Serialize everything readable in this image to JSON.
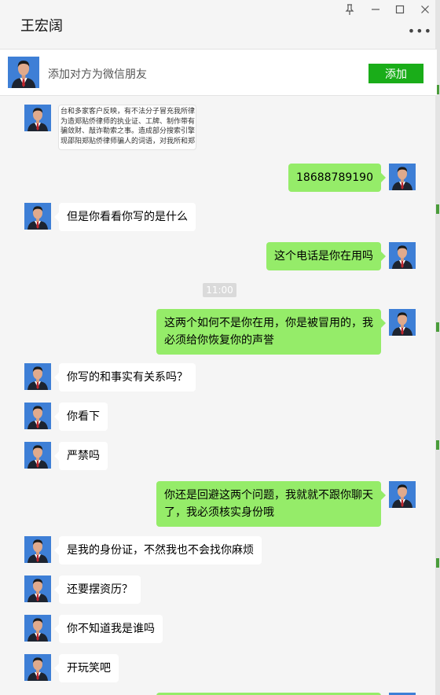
{
  "window": {
    "title": "王宏阔",
    "pin_icon": "pin-icon",
    "minimize_icon": "minimize-icon",
    "maximize_icon": "maximize-icon",
    "close_icon": "close-icon",
    "more_icon": "more-icon"
  },
  "add_bar": {
    "text": "添加对方为微信朋友",
    "button_label": "添加",
    "button_color": "#1aad19"
  },
  "colors": {
    "incoming_bubble": "#ffffff",
    "outgoing_bubble": "#95ec69",
    "avatar_background": "#3e7fd6"
  },
  "image_message": {
    "lines": [
      "台和多家客户反映，有不法分子冒充我所律",
      "为造郑贴侨律师的执业证、工牌、制作带有",
      "骗敛财、敲诈勒索之事。造成部分搜索引擎",
      "现邵阳郑贴侨律师骗人的词语，对我所和郑"
    ]
  },
  "time_divider": "11:00",
  "messages": [
    {
      "direction": "out",
      "text": "18688789190"
    },
    {
      "direction": "in",
      "text": "但是你看看你写的是什么"
    },
    {
      "direction": "out",
      "text": "这个电话是你在用吗"
    },
    {
      "direction": "out",
      "text": "这两个如何不是你在用，你是被冒用的，我必须给你恢复你的声誉"
    },
    {
      "direction": "in",
      "text": "你写的和事实有关系吗？"
    },
    {
      "direction": "in",
      "text": "你看下"
    },
    {
      "direction": "in",
      "text": "严禁吗"
    },
    {
      "direction": "out",
      "text": "你还是回避这两个问题，我就就不跟你聊天了，我必须核实身份哦"
    },
    {
      "direction": "in",
      "text": "是我的身份证，不然我也不会找你麻烦"
    },
    {
      "direction": "in",
      "text": "还要摆资历？"
    },
    {
      "direction": "in",
      "text": "你不知道我是谁吗"
    },
    {
      "direction": "in",
      "text": "开玩笑吧"
    }
  ]
}
